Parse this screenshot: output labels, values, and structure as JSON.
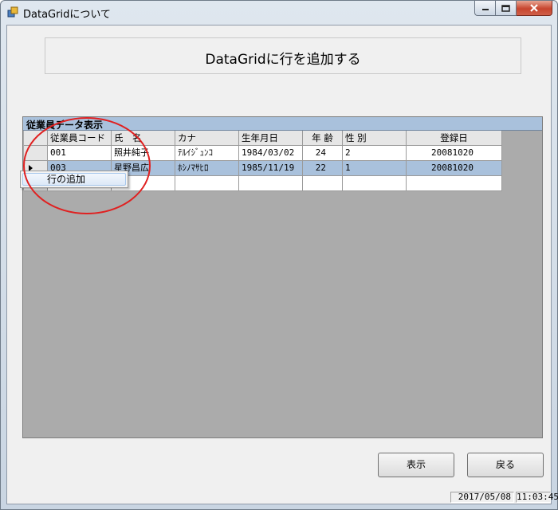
{
  "window": {
    "title": "DataGridについて"
  },
  "header": {
    "title": "DataGridに行を追加する"
  },
  "grid": {
    "caption": "従業員データ表示",
    "columns": [
      "従業員コード",
      "氏　名",
      "カナ",
      "生年月日",
      "年 齢",
      "性 別",
      "登録日"
    ],
    "rows": [
      [
        "001",
        "照井純子",
        "ﾃﾙｲｼﾞｭﾝｺ",
        "1984/03/02",
        "24",
        "2",
        "20081020"
      ],
      [
        "003",
        "星野昌広",
        "ﾎｼﾉﾏｻﾋﾛ",
        "1985/11/19",
        "22",
        "1",
        "20081020"
      ],
      [
        "",
        "",
        "",
        "",
        "",
        "",
        ""
      ]
    ],
    "selected_row": 1
  },
  "context_menu": {
    "items": [
      "行の追加"
    ]
  },
  "buttons": {
    "show": "表示",
    "back": "戻る"
  },
  "status": {
    "date": "2017/05/08",
    "time": "11:03:45"
  },
  "colors": {
    "selection": "#a9c1dc",
    "annotation": "#e02020"
  },
  "icons": {
    "window": "app-window-icon",
    "minimize": "minimize-icon",
    "maximize": "maximize-icon",
    "close": "close-icon"
  }
}
